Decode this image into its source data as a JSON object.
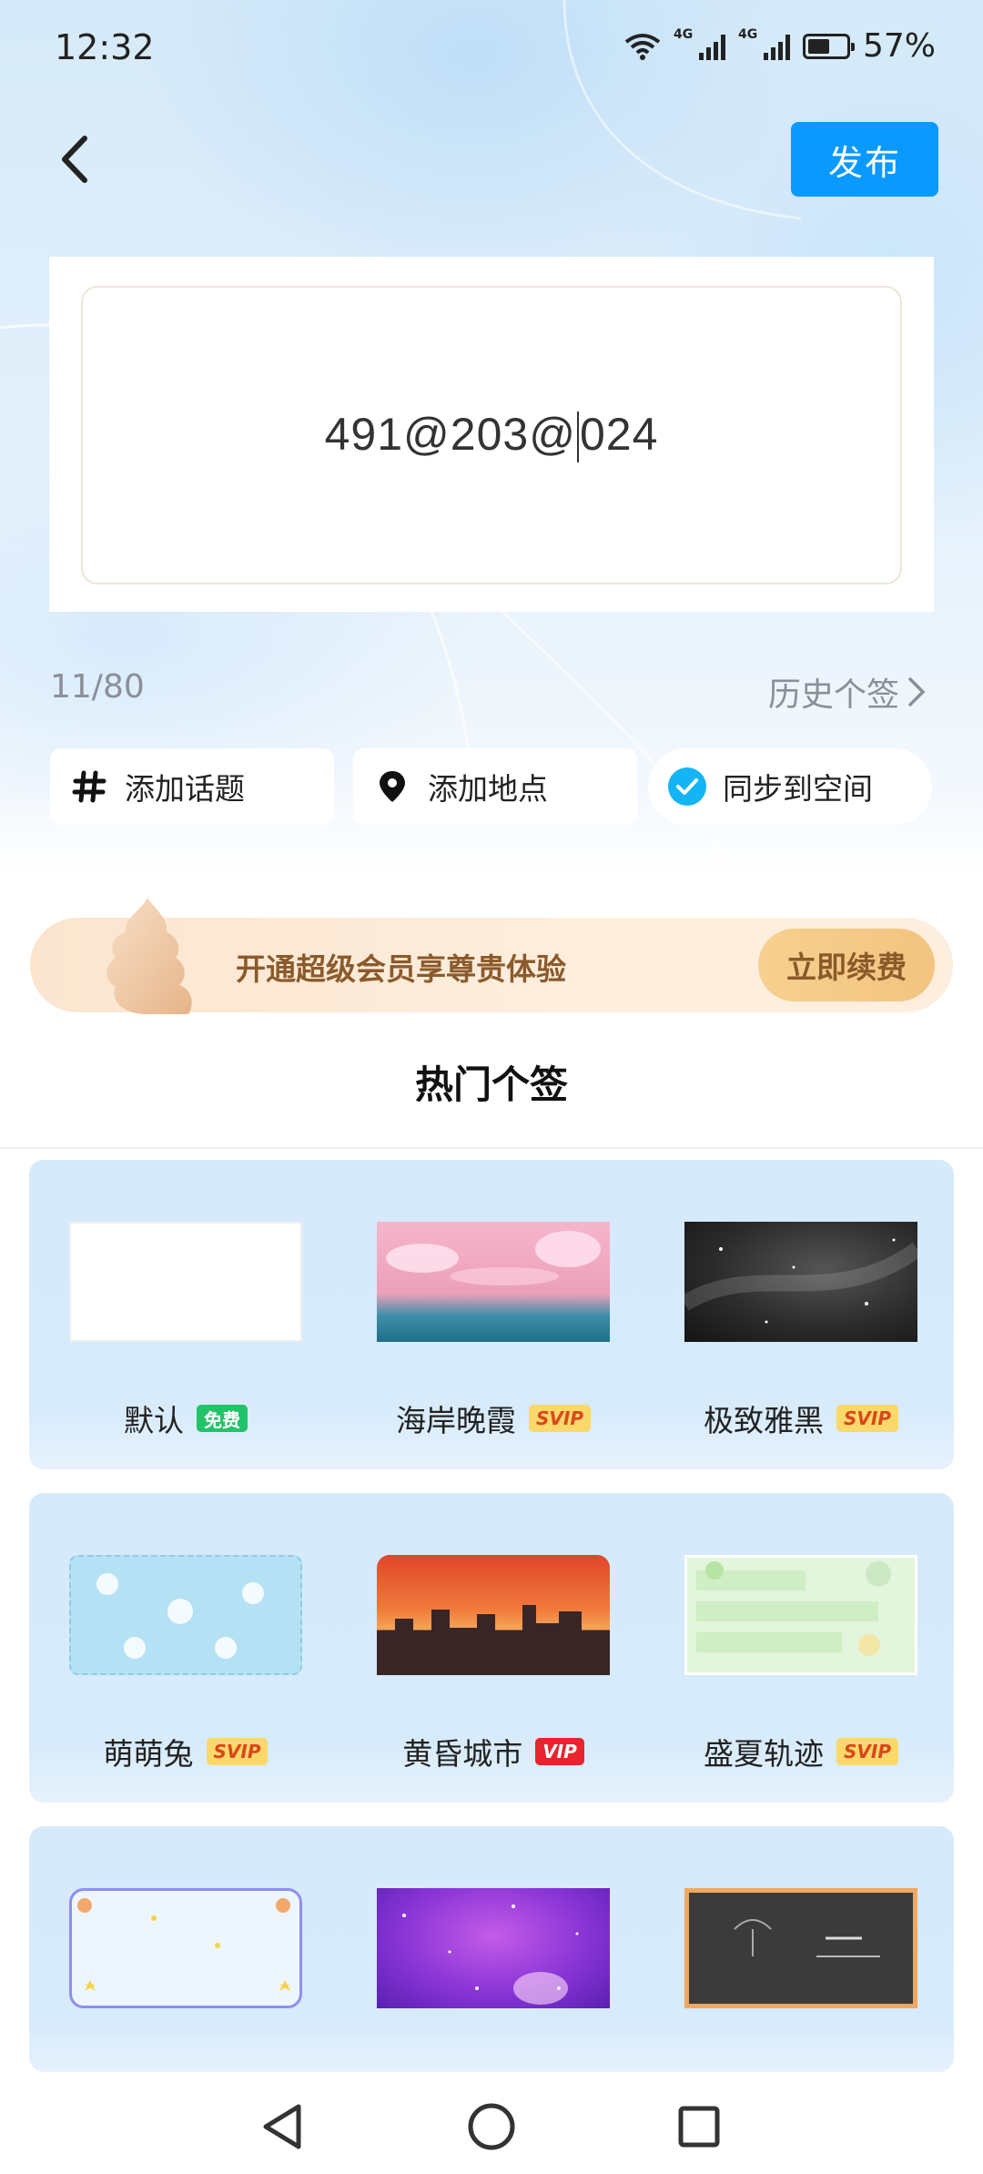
{
  "status": {
    "time": "12:32",
    "network_1": "4G",
    "network_2": "4G",
    "battery": "57%",
    "battery_level": 0.57
  },
  "header": {
    "publish_label": "发布"
  },
  "editor": {
    "text_before": "491@203@",
    "text_after": "024"
  },
  "meta": {
    "char_count": "11/80",
    "history_label": "历史个签"
  },
  "chips": [
    {
      "label": "添加话题",
      "icon": "hash-icon"
    },
    {
      "label": "添加地点",
      "icon": "location-pin-icon"
    },
    {
      "label": "同步到空间",
      "icon": "checkmark-circle-icon",
      "checked": true
    }
  ],
  "promo": {
    "text": "开通超级会员享尊贵体验",
    "button": "立即续费"
  },
  "section_title": "热门个签",
  "templates": [
    {
      "name": "默认",
      "badge": "免费",
      "badge_type": "free"
    },
    {
      "name": "海岸晚霞",
      "badge": "SVIP",
      "badge_type": "svip"
    },
    {
      "name": "极致雅黑",
      "badge": "SVIP",
      "badge_type": "svip"
    },
    {
      "name": "萌萌兔",
      "badge": "SVIP",
      "badge_type": "svip"
    },
    {
      "name": "黄昏城市",
      "badge": "VIP",
      "badge_type": "vip"
    },
    {
      "name": "盛夏轨迹",
      "badge": "SVIP",
      "badge_type": "svip"
    }
  ],
  "colors": {
    "accent": "#0a99ff",
    "check": "#14b4f5",
    "free": "#22c46a",
    "svip": "#fbd86a",
    "vip": "#e9242f"
  }
}
